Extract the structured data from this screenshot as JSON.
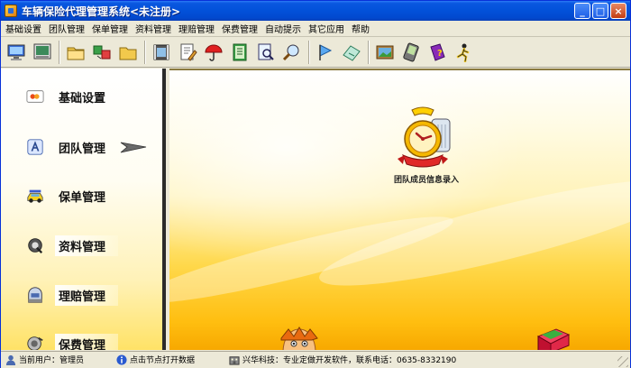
{
  "window": {
    "title": "车辆保险代理管理系统<未注册>",
    "controls": {
      "minimize": "_",
      "maximize": "□",
      "close": "×"
    }
  },
  "menu": [
    "基础设置",
    "团队管理",
    "保单管理",
    "资料管理",
    "理赔管理",
    "保费管理",
    "自动提示",
    "其它应用",
    "帮助"
  ],
  "toolbar": {
    "icons": [
      "monitor-icon",
      "screen-icon",
      "folder-icon",
      "folder-exchange-icon",
      "folder-plain-icon",
      "film-icon",
      "document-edit-icon",
      "umbrella-icon",
      "notebook-icon",
      "search-document-icon",
      "magnifier-icon",
      "flag-icon",
      "map-icon",
      "picture-icon",
      "pda-icon",
      "help-book-icon",
      "runner-icon"
    ]
  },
  "sidebar": {
    "items": [
      {
        "label": "基础设置",
        "icon": "card-icon"
      },
      {
        "label": "团队管理",
        "icon": "team-icon"
      },
      {
        "label": "保单管理",
        "icon": "car-icon"
      },
      {
        "label": "资料管理",
        "icon": "data-icon"
      },
      {
        "label": "理赔管理",
        "icon": "claim-icon"
      },
      {
        "label": "保费管理",
        "icon": "premium-icon"
      }
    ],
    "active_index": 1
  },
  "main": {
    "feature_label": "团队成员信息录入",
    "feature_icon": "alarm-clock-icon"
  },
  "status": {
    "user": "当前用户：管理员",
    "hint": "点击节点打开数据",
    "company": "兴华科技：专业定做开发软件，联系电话：0635-8332190"
  },
  "colors": {
    "titlebar": "#0251d9",
    "sidebar_divider": "#2a2a2a",
    "main_gold": "#ffbe10"
  }
}
